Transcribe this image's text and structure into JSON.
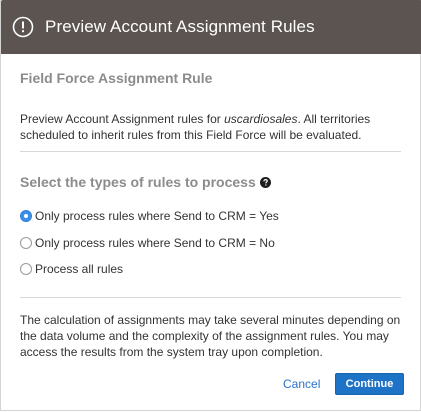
{
  "dialog": {
    "title": "Preview Account Assignment Rules",
    "header_icon": "info-icon"
  },
  "section": {
    "title": "Field Force Assignment Rule",
    "description_prefix": "Preview Account Assignment rules for ",
    "field_force_name": "uscardiosales",
    "description_suffix": ". All territories scheduled to inherit rules from this Field Force will be evaluated."
  },
  "rules": {
    "title": "Select the types of rules to process",
    "help_icon": "help-icon",
    "options": [
      {
        "label": "Only process rules where Send to CRM = Yes",
        "checked": true
      },
      {
        "label": "Only process rules where Send to CRM = No",
        "checked": false
      },
      {
        "label": "Process all rules",
        "checked": false
      }
    ]
  },
  "note": "The calculation of assignments may take several minutes depending on the data volume and the complexity of the assignment rules. You may access the results from the system tray upon completion.",
  "footer": {
    "cancel_label": "Cancel",
    "continue_label": "Continue"
  },
  "colors": {
    "header_bg": "#5b5450",
    "accent": "#1f73c7",
    "muted_heading": "#8c8c8c"
  }
}
